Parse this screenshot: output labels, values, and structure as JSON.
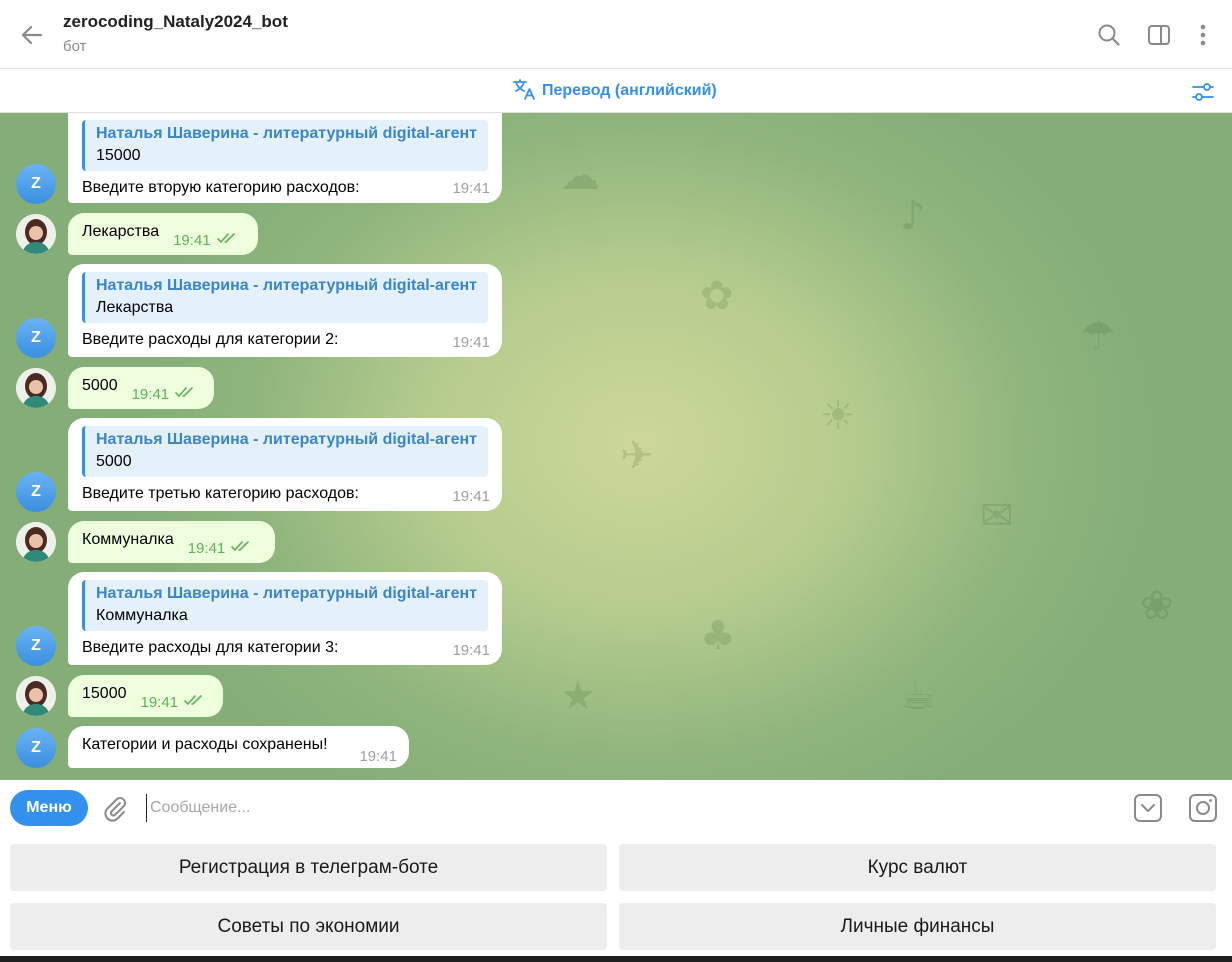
{
  "header": {
    "title": "zerocoding_Nataly2024_bot",
    "subtitle": "бот",
    "icons": [
      "back-arrow-icon",
      "search-icon",
      "sidebar-toggle-icon",
      "more-vertical-icon"
    ]
  },
  "translate_bar": {
    "label": "Перевод (английский)",
    "icon": "translate-icon",
    "settings_icon": "sliders-icon"
  },
  "bot_avatar_letter": "Z",
  "messages": [
    {
      "from": "bot",
      "quote_name": "Наталья Шаверина - литературный digital-агент",
      "quote_text": "15000",
      "text": "Введите вторую категорию расходов:",
      "time": "19:41"
    },
    {
      "from": "user",
      "text": "Лекарства",
      "time": "19:41",
      "status": "read"
    },
    {
      "from": "bot",
      "quote_name": "Наталья Шаверина - литературный digital-агент",
      "quote_text": "Лекарства",
      "text": "Введите расходы для категории 2:",
      "time": "19:41"
    },
    {
      "from": "user",
      "text": "5000",
      "time": "19:41",
      "status": "read"
    },
    {
      "from": "bot",
      "quote_name": "Наталья Шаверина - литературный digital-агент",
      "quote_text": "5000",
      "text": "Введите третью категорию расходов:",
      "time": "19:41"
    },
    {
      "from": "user",
      "text": "Коммуналка",
      "time": "19:41",
      "status": "read"
    },
    {
      "from": "bot",
      "quote_name": "Наталья Шаверина - литературный digital-агент",
      "quote_text": "Коммуналка",
      "text": "Введите расходы для категории 3:",
      "time": "19:41"
    },
    {
      "from": "user",
      "text": "15000",
      "time": "19:41",
      "status": "read"
    },
    {
      "from": "bot",
      "text": "Категории и расходы сохранены!",
      "time": "19:41"
    }
  ],
  "input": {
    "menu_label": "Меню",
    "placeholder": "Сообщение...",
    "value": ""
  },
  "keyboard": {
    "buttons": [
      "Регистрация в телеграм-боте",
      "Курс валют",
      "Советы по экономии",
      "Личные финансы"
    ]
  },
  "colors": {
    "accent": "#3390ec",
    "incoming_bubble": "#ffffff",
    "outgoing_bubble": "#eeffde",
    "read_check": "#5fb157",
    "wallpaper": "#b6cc8e"
  }
}
